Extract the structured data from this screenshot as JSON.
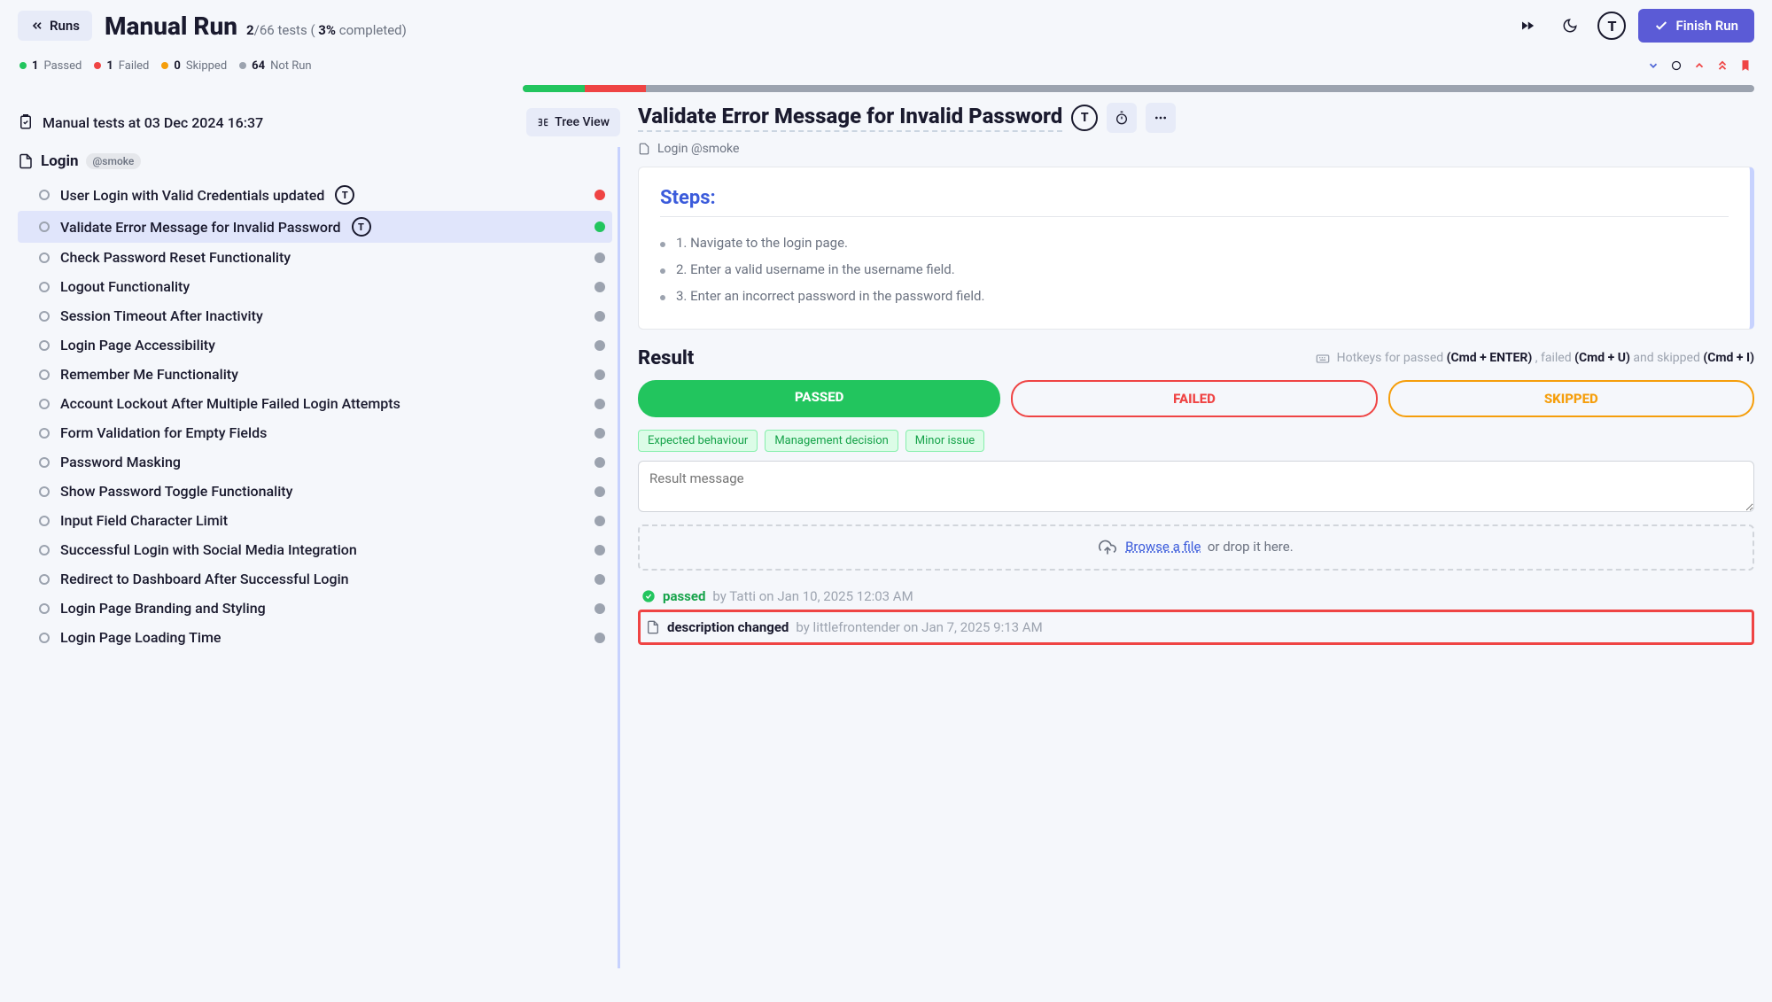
{
  "header": {
    "runs_label": "Runs",
    "title": "Manual Run",
    "progress_done": "2",
    "progress_total": "66",
    "progress_word": "tests",
    "progress_pct": "3%",
    "progress_completed": "completed)",
    "finish_label": "Finish Run"
  },
  "stats": {
    "passed_n": "1",
    "passed_l": "Passed",
    "failed_n": "1",
    "failed_l": "Failed",
    "skipped_n": "0",
    "skipped_l": "Skipped",
    "notrun_n": "64",
    "notrun_l": "Not Run"
  },
  "session": {
    "title": "Manual tests at 03 Dec 2024 16:37",
    "tree_btn": "Tree View"
  },
  "group": {
    "name": "Login",
    "tag": "@smoke"
  },
  "tests": [
    {
      "name": "User Login with Valid Credentials updated",
      "status": "red",
      "icon": true
    },
    {
      "name": "Validate Error Message for Invalid Password",
      "status": "green",
      "icon": true,
      "selected": true
    },
    {
      "name": "Check Password Reset Functionality",
      "status": "gray"
    },
    {
      "name": "Logout Functionality",
      "status": "gray"
    },
    {
      "name": "Session Timeout After Inactivity",
      "status": "gray"
    },
    {
      "name": "Login Page Accessibility",
      "status": "gray"
    },
    {
      "name": "Remember Me Functionality",
      "status": "gray"
    },
    {
      "name": "Account Lockout After Multiple Failed Login Attempts",
      "status": "gray"
    },
    {
      "name": "Form Validation for Empty Fields",
      "status": "gray"
    },
    {
      "name": "Password Masking",
      "status": "gray"
    },
    {
      "name": "Show Password Toggle Functionality",
      "status": "gray"
    },
    {
      "name": "Input Field Character Limit",
      "status": "gray"
    },
    {
      "name": "Successful Login with Social Media Integration",
      "status": "gray"
    },
    {
      "name": "Redirect to Dashboard After Successful Login",
      "status": "gray"
    },
    {
      "name": "Login Page Branding and Styling",
      "status": "gray"
    },
    {
      "name": "Login Page Loading Time",
      "status": "gray"
    }
  ],
  "detail": {
    "title": "Validate Error Message for Invalid Password",
    "crumb": "Login @smoke",
    "steps_hdr": "Steps:",
    "steps": [
      "1. Navigate to the login page.",
      "2. Enter a valid username in the username field.",
      "3. Enter an incorrect password in the password field."
    ]
  },
  "result": {
    "title": "Result",
    "hotkeys_prefix": "Hotkeys for passed",
    "hk1": "(Cmd + ENTER)",
    "hk_mid1": ", failed",
    "hk2": "(Cmd + U)",
    "hk_mid2": "and skipped",
    "hk3": "(Cmd + I)",
    "btn_passed": "PASSED",
    "btn_failed": "FAILED",
    "btn_skipped": "SKIPPED",
    "chips": [
      "Expected behaviour",
      "Management decision",
      "Minor issue"
    ],
    "msg_placeholder": "Result message",
    "drop_browse": "Browse a file",
    "drop_rest": "or drop it here."
  },
  "history": [
    {
      "kw": "passed",
      "kw_cls": "green",
      "meta": "by Tatti on Jan 10, 2025 12:03 AM",
      "icon": "check"
    },
    {
      "kw": "description changed",
      "kw_cls": "",
      "meta": "by littlefrontender on Jan 7, 2025 9:13 AM",
      "icon": "doc",
      "highlight": true
    }
  ]
}
